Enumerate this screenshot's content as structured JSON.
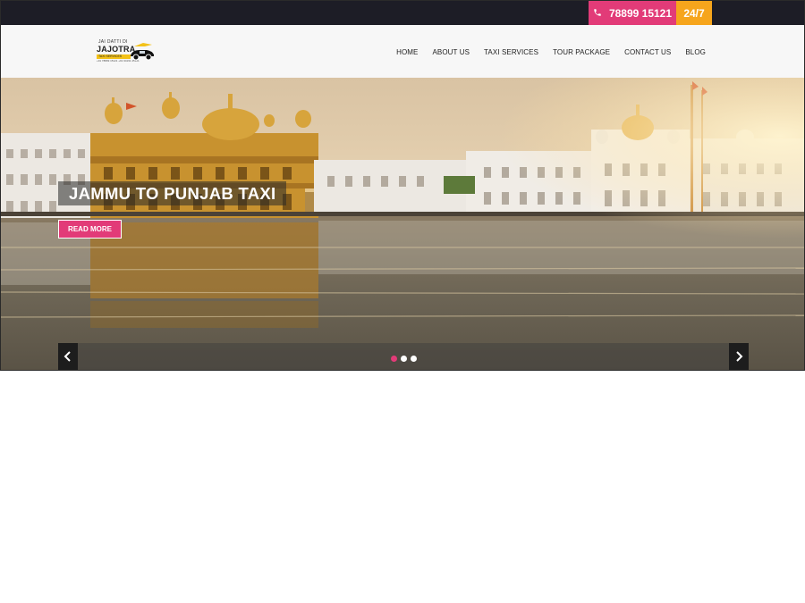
{
  "topbar": {
    "phone": "78899 15121",
    "hours": "24/7",
    "phone_icon": "phone-icon",
    "colors": {
      "bar": "#1d1d26",
      "phone_bg": "#e23b78",
      "hours_bg": "#f6a51c"
    }
  },
  "logo": {
    "line1": "JAI DATTI DI",
    "line2": "JAJOTRA",
    "line3": "TAXI SERVICES",
    "line4": "+91 78899 15121 +91 94191 45121"
  },
  "nav": {
    "items": [
      "HOME",
      "ABOUT US",
      "TAXI SERVICES",
      "TOUR PACKAGE",
      "CONTACT US",
      "BLOG"
    ]
  },
  "hero": {
    "title": "JAMMU TO PUNJAB TAXI",
    "button": "READ MORE",
    "prev_icon": "chevron-left-icon",
    "next_icon": "chevron-right-icon",
    "slides": 3,
    "active_slide": 1,
    "accent": "#e23b78"
  }
}
